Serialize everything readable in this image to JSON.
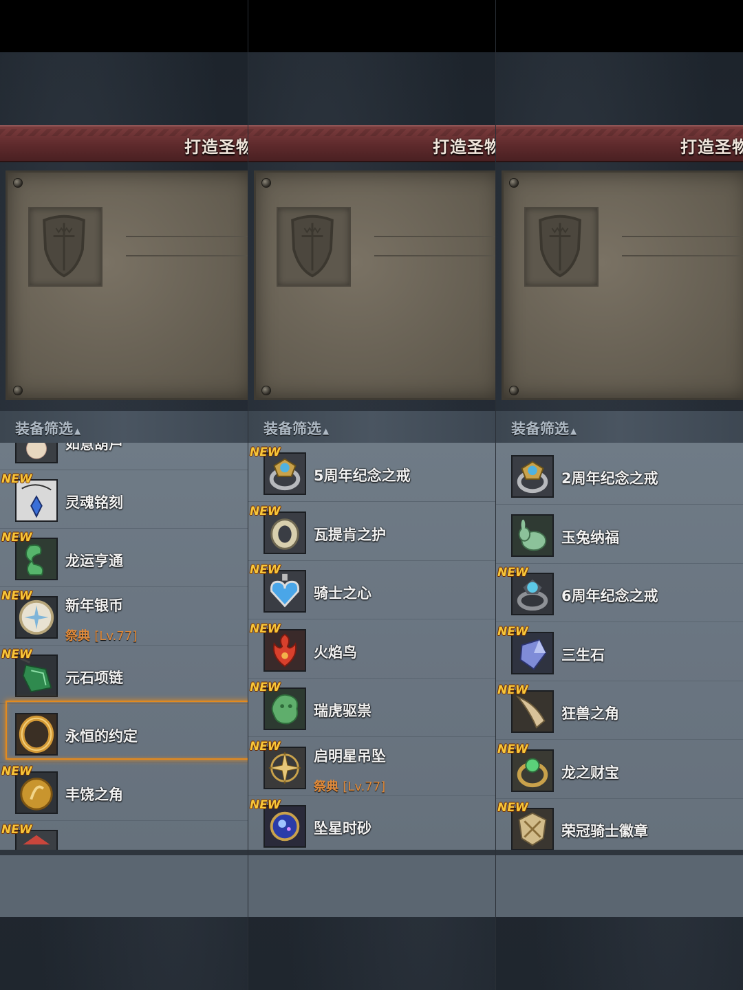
{
  "header": {
    "title": "打造圣物"
  },
  "filter": {
    "label": "装备筛选",
    "arrow": "▲"
  },
  "colors": {
    "accent_orange": "#e28a1f",
    "new_badge": "#f7c63a",
    "tag_orange": "#e08a3a"
  },
  "panels": [
    {
      "items": [
        {
          "name": "如意葫芦",
          "new": "",
          "icon": "gourd-icon",
          "tag": "",
          "tag_lv": ""
        },
        {
          "name": "灵魂铭刻",
          "new": "NEW",
          "icon": "soul-pendant-icon",
          "tag": "",
          "tag_lv": ""
        },
        {
          "name": "龙运亨通",
          "new": "NEW",
          "icon": "jade-dragon-icon",
          "tag": "",
          "tag_lv": ""
        },
        {
          "name": "新年银币",
          "new": "NEW",
          "icon": "silver-coin-icon",
          "tag": "祭典",
          "tag_lv": "[Lv.77]"
        },
        {
          "name": "元石项链",
          "new": "NEW",
          "icon": "green-gem-necklace-icon",
          "tag": "",
          "tag_lv": ""
        },
        {
          "name": "永恒的约定",
          "new": "",
          "icon": "gold-ring-icon",
          "tag": "",
          "tag_lv": ""
        },
        {
          "name": "丰饶之角",
          "new": "NEW",
          "icon": "gold-coin-icon",
          "tag": "",
          "tag_lv": ""
        },
        {
          "name": "",
          "new": "NEW",
          "icon": "partial-item-icon",
          "tag": "",
          "tag_lv": ""
        }
      ]
    },
    {
      "items": [
        {
          "name": "5周年纪念之戒",
          "new": "NEW",
          "icon": "anniversary-ring-icon",
          "tag": "",
          "tag_lv": ""
        },
        {
          "name": "瓦提肯之护",
          "new": "NEW",
          "icon": "silver-ring-icon",
          "tag": "",
          "tag_lv": ""
        },
        {
          "name": "骑士之心",
          "new": "NEW",
          "icon": "heart-pendant-icon",
          "tag": "",
          "tag_lv": ""
        },
        {
          "name": "火焰鸟",
          "new": "NEW",
          "icon": "fire-bird-icon",
          "tag": "",
          "tag_lv": ""
        },
        {
          "name": "瑞虎驱祟",
          "new": "NEW",
          "icon": "jade-tiger-icon",
          "tag": "",
          "tag_lv": ""
        },
        {
          "name": "启明星吊坠",
          "new": "NEW",
          "icon": "star-pendant-icon",
          "tag": "祭典",
          "tag_lv": "[Lv.77]"
        },
        {
          "name": "坠星时砂",
          "new": "NEW",
          "icon": "hourglass-orb-icon",
          "tag": "",
          "tag_lv": ""
        }
      ]
    },
    {
      "items": [
        {
          "name": "2周年纪念之戒",
          "new": "",
          "icon": "anniversary-ring-icon",
          "tag": "",
          "tag_lv": ""
        },
        {
          "name": "玉兔纳福",
          "new": "",
          "icon": "jade-rabbit-icon",
          "tag": "",
          "tag_lv": ""
        },
        {
          "name": "6周年纪念之戒",
          "new": "NEW",
          "icon": "blue-gem-ring-icon",
          "tag": "",
          "tag_lv": ""
        },
        {
          "name": "三生石",
          "new": "NEW",
          "icon": "crystal-stone-icon",
          "tag": "",
          "tag_lv": ""
        },
        {
          "name": "狂兽之角",
          "new": "NEW",
          "icon": "beast-horn-icon",
          "tag": "",
          "tag_lv": ""
        },
        {
          "name": "龙之财宝",
          "new": "NEW",
          "icon": "green-gem-ring-icon",
          "tag": "",
          "tag_lv": ""
        },
        {
          "name": "荣冠骑士徽章",
          "new": "NEW",
          "icon": "knight-badge-icon",
          "tag": "",
          "tag_lv": ""
        }
      ]
    }
  ]
}
